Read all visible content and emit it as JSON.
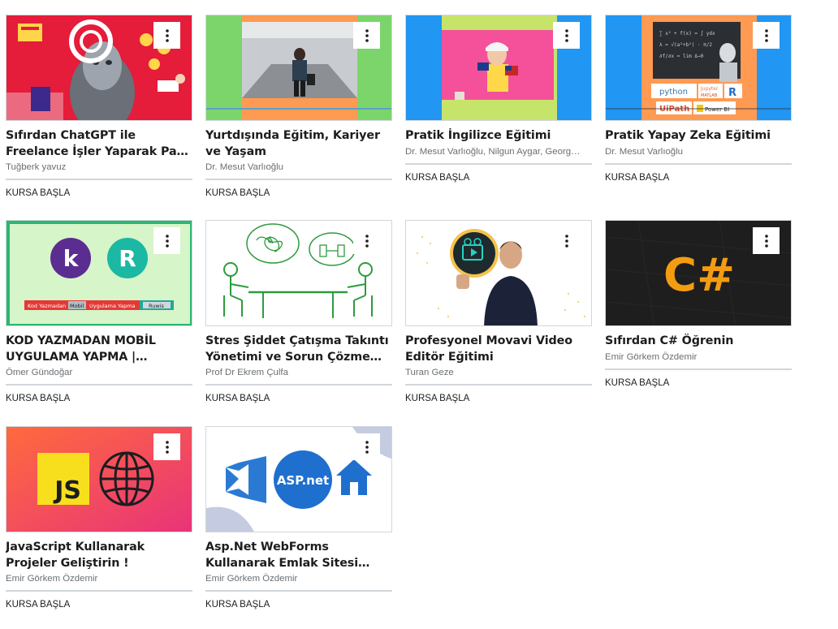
{
  "courses": [
    {
      "title": "Sıfırdan ChatGPT ile Freelance İşler Yaparak Para Kazanma",
      "instructor": "Tuğberk yavuz",
      "action": "KURSA BAŞLA",
      "thumb_bg": "#e51c3a"
    },
    {
      "title": "Yurtdışında Eğitim, Kariyer ve Yaşam",
      "instructor": "Dr. Mesut Varlıoğlu",
      "action": "KURSA BAŞLA",
      "thumb_bg": "#7bd56a"
    },
    {
      "title": "Pratik İngilizce Eğitimi",
      "instructor": "Dr. Mesut Varlıoğlu, Nilgun Aygar, Georg…",
      "action": "KURSA BAŞLA",
      "thumb_bg": "#2196f3"
    },
    {
      "title": "Pratik Yapay Zeka Eğitimi",
      "instructor": "Dr. Mesut Varlıoğlu",
      "action": "KURSA BAŞLA",
      "thumb_bg": "#2196f3"
    },
    {
      "title": "KOD YAZMADAN MOBİL UYGULAMA YAPMA | Kodular…",
      "instructor": "Ömer Gündoğar",
      "action": "KURSA BAŞLA",
      "thumb_bg": "#d6f5c9"
    },
    {
      "title": "Stres Şiddet Çatışma Takıntı Yönetimi ve Sorun Çözme…",
      "instructor": "Prof Dr Ekrem Çulfa",
      "action": "KURSA BAŞLA",
      "thumb_bg": "#ffffff"
    },
    {
      "title": "Profesyonel Movavi Video Editör Eğitimi",
      "instructor": "Turan Geze",
      "action": "KURSA BAŞLA",
      "thumb_bg": "#ffffff"
    },
    {
      "title": "Sıfırdan C# Öğrenin",
      "instructor": "Emir Görkem Özdemir",
      "action": "KURSA BAŞLA",
      "thumb_bg": "#1e1e1e"
    },
    {
      "title": "JavaScript Kullanarak Projeler Geliştirin !",
      "instructor": "Emir Görkem Özdemir",
      "action": "KURSA BAŞLA",
      "thumb_bg": "#f0446a"
    },
    {
      "title": "Asp.Net WebForms Kullanarak Emlak Sitesi Yapıyoruz",
      "instructor": "Emir Görkem Özdemir",
      "action": "KURSA BAŞLA",
      "thumb_bg": "#ffffff"
    }
  ],
  "thumb_text": {
    "python": "python",
    "jupyter": "Jupyter",
    "matlab": "MATLAB",
    "r": "R",
    "uipath": "UiPath",
    "powerbi": "Power BI",
    "k_letter": "k",
    "r_letter": "R",
    "kod_banner_1": "Kod Yazmadan",
    "kod_banner_2": "Mobil",
    "kod_banner_3": "Uygulama Yapma",
    "kod_banner_4": "Ruwis",
    "csharp": "C#",
    "js": "JS",
    "aspnet": "ASP.net"
  }
}
